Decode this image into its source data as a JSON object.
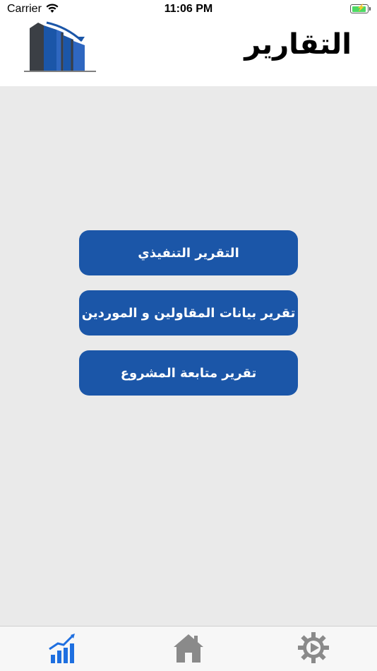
{
  "status_bar": {
    "carrier": "Carrier",
    "time": "11:06 PM",
    "battery_charging": true
  },
  "header": {
    "title": "التقارير",
    "logo_icon": "building-growth-logo"
  },
  "reports": {
    "buttons": [
      {
        "label": "التقرير التنفيذي"
      },
      {
        "label": "تقرير بيانات المقاولين و الموردين"
      },
      {
        "label": "تقرير متابعة المشروع"
      }
    ]
  },
  "tab_bar": {
    "items": [
      {
        "icon": "chart-growth-icon",
        "active": true
      },
      {
        "icon": "home-icon",
        "active": false
      },
      {
        "icon": "gear-icon",
        "active": false
      }
    ]
  },
  "colors": {
    "accent": "#1b56a8",
    "active_tab": "#1e6fe0",
    "inactive_tab": "#8a8a8a",
    "background": "#eaeaea"
  }
}
